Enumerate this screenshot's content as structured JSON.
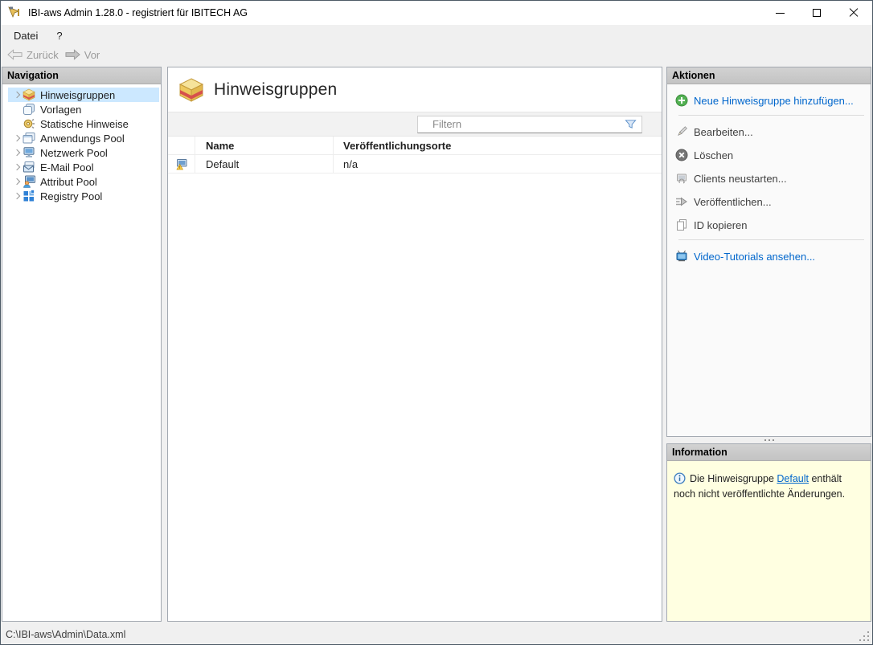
{
  "window": {
    "title": "IBI-aws Admin 1.28.0 - registriert für IBITECH AG"
  },
  "menu": {
    "datei": "Datei",
    "help": "?"
  },
  "toolbar": {
    "back": "Zurück",
    "forward": "Vor"
  },
  "navigation": {
    "header": "Navigation",
    "items": [
      {
        "label": "Hinweisgruppen",
        "selected": true,
        "expandable": true
      },
      {
        "label": "Vorlagen",
        "selected": false,
        "expandable": false
      },
      {
        "label": "Statische Hinweise",
        "selected": false,
        "expandable": false
      },
      {
        "label": "Anwendungs Pool",
        "selected": false,
        "expandable": true
      },
      {
        "label": "Netzwerk Pool",
        "selected": false,
        "expandable": true
      },
      {
        "label": "E-Mail Pool",
        "selected": false,
        "expandable": true
      },
      {
        "label": "Attribut Pool",
        "selected": false,
        "expandable": true
      },
      {
        "label": "Registry Pool",
        "selected": false,
        "expandable": true
      }
    ]
  },
  "main": {
    "title": "Hinweisgruppen",
    "filter": {
      "placeholder": "Filtern"
    },
    "table": {
      "columns": {
        "name": "Name",
        "locations": "Veröffentlichungsorte"
      },
      "rows": [
        {
          "name": "Default",
          "locations": "n/a"
        }
      ]
    }
  },
  "actions": {
    "header": "Aktionen",
    "add": "Neue Hinweisgruppe hinzufügen...",
    "edit": "Bearbeiten...",
    "delete": "Löschen",
    "restart": "Clients neustarten...",
    "publish": "Veröffentlichen...",
    "copy_id": "ID kopieren",
    "videos": "Video-Tutorials ansehen..."
  },
  "information": {
    "header": "Information",
    "text_before": "Die Hinweisgruppe ",
    "link": "Default",
    "text_after": " enthält noch nicht veröffentlichte Änderungen."
  },
  "statusbar": {
    "path": "C:\\IBI-aws\\Admin\\Data.xml"
  },
  "icons": {
    "app": "gold-hand-pointer",
    "back": "arrow-left",
    "forward": "arrow-right",
    "hinweisgruppen": "gold-package-red-stripe",
    "vorlagen": "stacked-pages",
    "statische_hinweise": "gold-gear",
    "anwendungs_pool": "stacked-windows",
    "netzwerk_pool": "network-monitor",
    "email_pool": "envelope",
    "attribut_pool": "monitor-person",
    "registry_pool": "blue-grid",
    "filter": "funnel",
    "row_default": "window-warning",
    "add": "green-plus-circle",
    "edit": "pencil",
    "delete": "gray-x-circle",
    "restart": "faded-monitor",
    "publish": "gray-arrow-lines",
    "copy_id": "copy-pages",
    "videos": "blue-tv",
    "info": "blue-info-circle"
  },
  "colors": {
    "selection": "#cce8ff",
    "link": "#0066cc",
    "info_bg": "#ffffe1",
    "panel_header_bg": "#c8c8c8",
    "add_green": "#5cb85c",
    "tv_blue": "#3d8fd1"
  }
}
